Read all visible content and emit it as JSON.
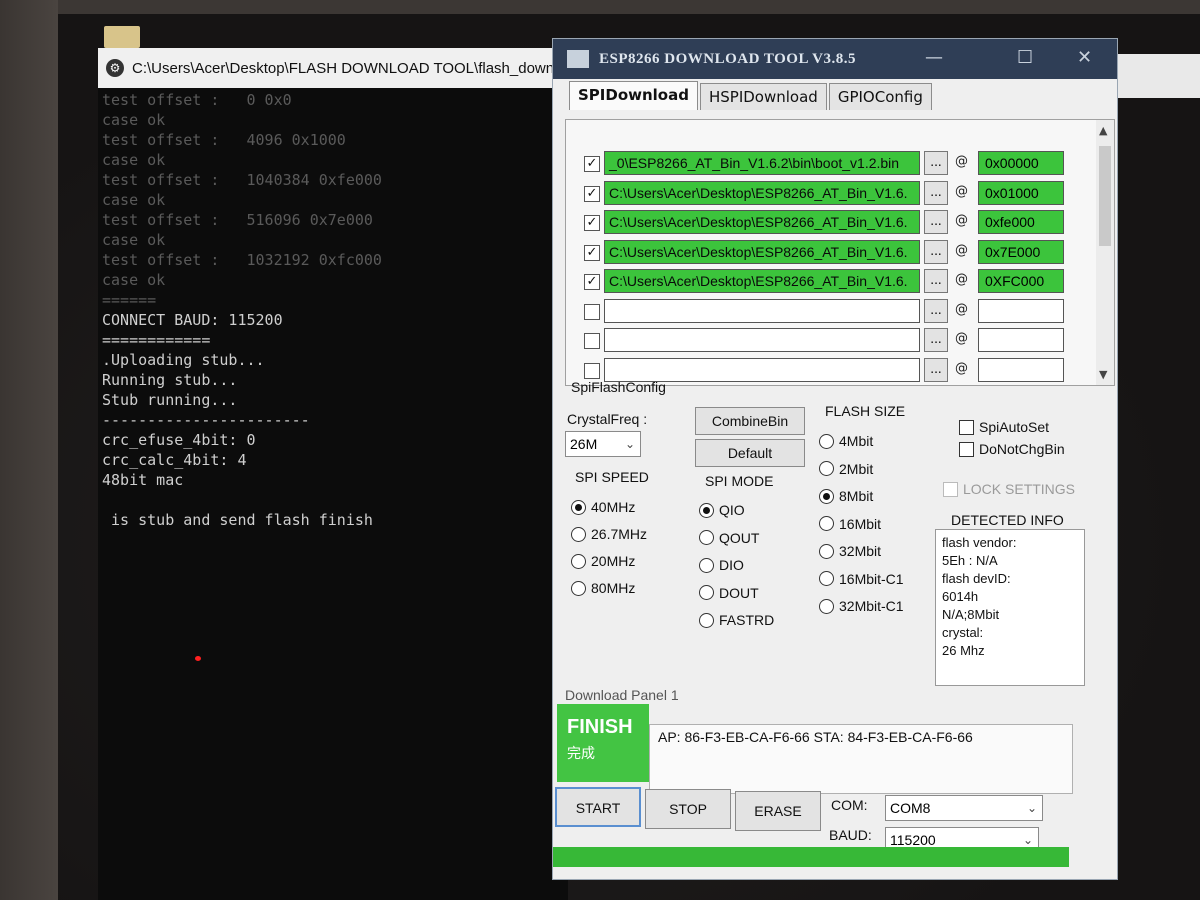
{
  "console": {
    "title": "C:\\Users\\Acer\\Desktop\\FLASH DOWNLOAD TOOL\\flash_downlo",
    "lines": [
      {
        "text": "test offset :   0 0x0",
        "dim": true
      },
      {
        "text": "case ok",
        "dim": true
      },
      {
        "text": "test offset :   4096 0x1000",
        "dim": true
      },
      {
        "text": "case ok",
        "dim": true
      },
      {
        "text": "test offset :   1040384 0xfe000",
        "dim": true
      },
      {
        "text": "case ok",
        "dim": true
      },
      {
        "text": "test offset :   516096 0x7e000",
        "dim": true
      },
      {
        "text": "case ok",
        "dim": true
      },
      {
        "text": "test offset :   1032192 0xfc000",
        "dim": true
      },
      {
        "text": "case ok",
        "dim": true
      },
      {
        "text": "======",
        "dim": true
      },
      {
        "text": "CONNECT BAUD: 115200",
        "dim": false
      },
      {
        "text": "============",
        "dim": false
      },
      {
        "text": ".Uploading stub...",
        "dim": false
      },
      {
        "text": "Running stub...",
        "dim": false
      },
      {
        "text": "Stub running...",
        "dim": false
      },
      {
        "text": "-----------------------",
        "dim": false
      },
      {
        "text": "crc_efuse_4bit: 0",
        "dim": false
      },
      {
        "text": "crc_calc_4bit: 4",
        "dim": false
      },
      {
        "text": "48bit mac",
        "dim": false
      },
      {
        "text": "",
        "dim": false
      },
      {
        "text": " is stub and send flash finish",
        "dim": false
      }
    ]
  },
  "tool": {
    "title": "ESP8266 DOWNLOAD TOOL V3.8.5",
    "tabs": [
      "SPIDownload",
      "HSPIDownload",
      "GPIOConfig"
    ],
    "files": [
      {
        "checked": true,
        "path": "_0\\ESP8266_AT_Bin_V1.6.2\\bin\\boot_v1.2.bin",
        "dots": "...",
        "at": "@",
        "addr": "0x00000"
      },
      {
        "checked": true,
        "path": "C:\\Users\\Acer\\Desktop\\ESP8266_AT_Bin_V1.6.",
        "dots": "...",
        "at": "@",
        "addr": "0x01000"
      },
      {
        "checked": true,
        "path": "C:\\Users\\Acer\\Desktop\\ESP8266_AT_Bin_V1.6.",
        "dots": "...",
        "at": "@",
        "addr": "0xfe000"
      },
      {
        "checked": true,
        "path": "C:\\Users\\Acer\\Desktop\\ESP8266_AT_Bin_V1.6.",
        "dots": "...",
        "at": "@",
        "addr": "0x7E000"
      },
      {
        "checked": true,
        "path": "C:\\Users\\Acer\\Desktop\\ESP8266_AT_Bin_V1.6.",
        "dots": "...",
        "at": "@",
        "addr": "0XFC000"
      },
      {
        "checked": false,
        "path": "",
        "dots": "...",
        "at": "@",
        "addr": ""
      },
      {
        "checked": false,
        "path": "",
        "dots": "...",
        "at": "@",
        "addr": ""
      },
      {
        "checked": false,
        "path": "",
        "dots": "...",
        "at": "@",
        "addr": ""
      }
    ],
    "spi_flash_config_label": "SpiFlashConfig",
    "crystal_label": "CrystalFreq :",
    "crystal_value": "26M",
    "combine_button": "CombineBin",
    "default_button": "Default",
    "spi_speed_label": "SPI SPEED",
    "spi_speeds": [
      {
        "label": "40MHz",
        "selected": true
      },
      {
        "label": "26.7MHz",
        "selected": false
      },
      {
        "label": "20MHz",
        "selected": false
      },
      {
        "label": "80MHz",
        "selected": false
      }
    ],
    "spi_mode_label": "SPI MODE",
    "spi_modes": [
      {
        "label": "QIO",
        "selected": true
      },
      {
        "label": "QOUT",
        "selected": false
      },
      {
        "label": "DIO",
        "selected": false
      },
      {
        "label": "DOUT",
        "selected": false
      },
      {
        "label": "FASTRD",
        "selected": false
      }
    ],
    "flash_size_label": "FLASH SIZE",
    "flash_sizes": [
      {
        "label": "4Mbit",
        "selected": false
      },
      {
        "label": "2Mbit",
        "selected": false
      },
      {
        "label": "8Mbit",
        "selected": true
      },
      {
        "label": "16Mbit",
        "selected": false
      },
      {
        "label": "32Mbit",
        "selected": false
      },
      {
        "label": "16Mbit-C1",
        "selected": false
      },
      {
        "label": "32Mbit-C1",
        "selected": false
      }
    ],
    "spi_auto_set": "SpiAutoSet",
    "do_not_chg_bin": "DoNotChgBin",
    "lock_settings": "LOCK SETTINGS",
    "detected_info_label": "DETECTED INFO",
    "detected_info": [
      "flash vendor:",
      "5Eh : N/A",
      "flash devID:",
      "6014h",
      "N/A;8Mbit",
      "crystal:",
      "26 Mhz"
    ],
    "download_panel_label": "Download Panel 1",
    "status_en": "FINISH",
    "status_cn": "完成",
    "mac_text": "AP:  86-F3-EB-CA-F6-66  STA:  84-F3-EB-CA-F6-66",
    "start_button": "START",
    "stop_button": "STOP",
    "erase_button": "ERASE",
    "com_label": "COM:",
    "com_value": "COM8",
    "baud_label": "BAUD:",
    "baud_value": "115200",
    "progress": 1.0
  },
  "colors": {
    "green_fill": "#3cc43c",
    "title_bar": "#2f3e56",
    "console_bg": "#0c0c0c"
  }
}
